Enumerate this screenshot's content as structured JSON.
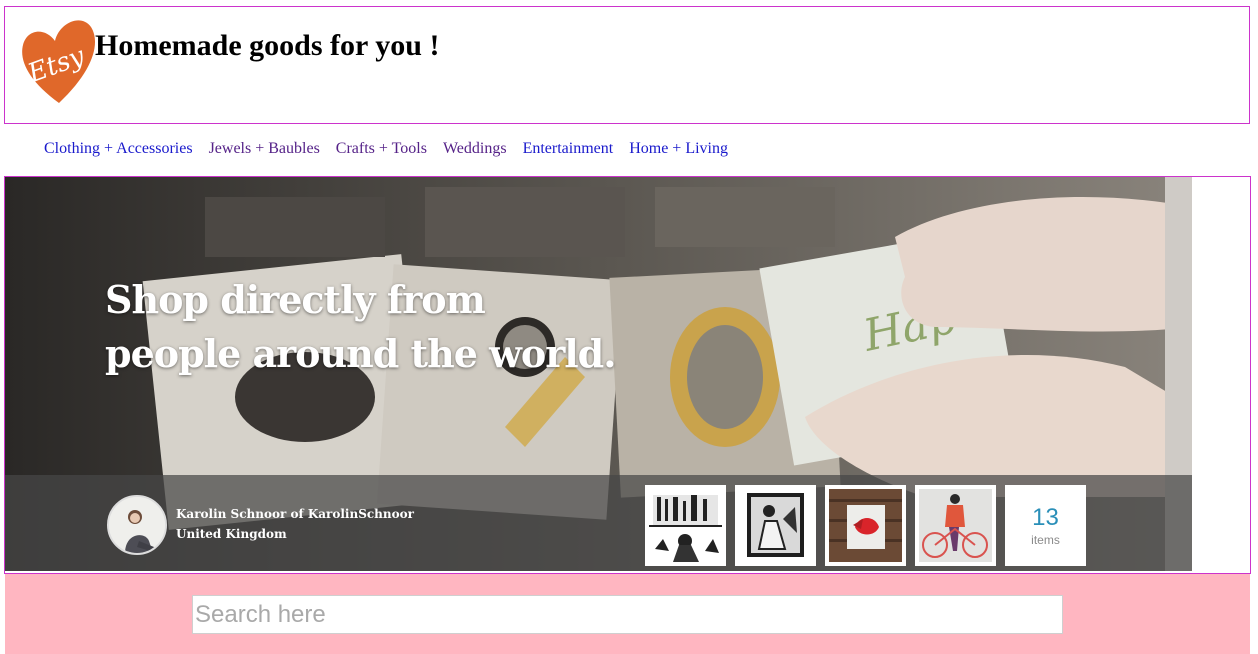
{
  "header": {
    "logo_text": "Etsy",
    "title": "Homemade goods for you !"
  },
  "nav": {
    "items": [
      {
        "label": "Clothing + Accessories"
      },
      {
        "label": "Jewels + Baubles"
      },
      {
        "label": "Crafts + Tools"
      },
      {
        "label": "Weddings"
      },
      {
        "label": "Entertainment"
      },
      {
        "label": "Home + Living"
      }
    ]
  },
  "hero": {
    "headline": "Shop directly from people around the world.",
    "seller": {
      "name": "Karolin Schnoor of KarolinSchnoor",
      "location": "United Kingdom"
    },
    "items": {
      "count": "13",
      "label": "items"
    }
  },
  "search": {
    "placeholder": "Search here"
  },
  "colors": {
    "logo_orange": "#e0682a",
    "header_border": "#cc33cc",
    "nav_link": "#1a1acc",
    "nav_visited": "#552288",
    "search_band": "#ffb6c1",
    "items_count": "#2a8fb8"
  }
}
